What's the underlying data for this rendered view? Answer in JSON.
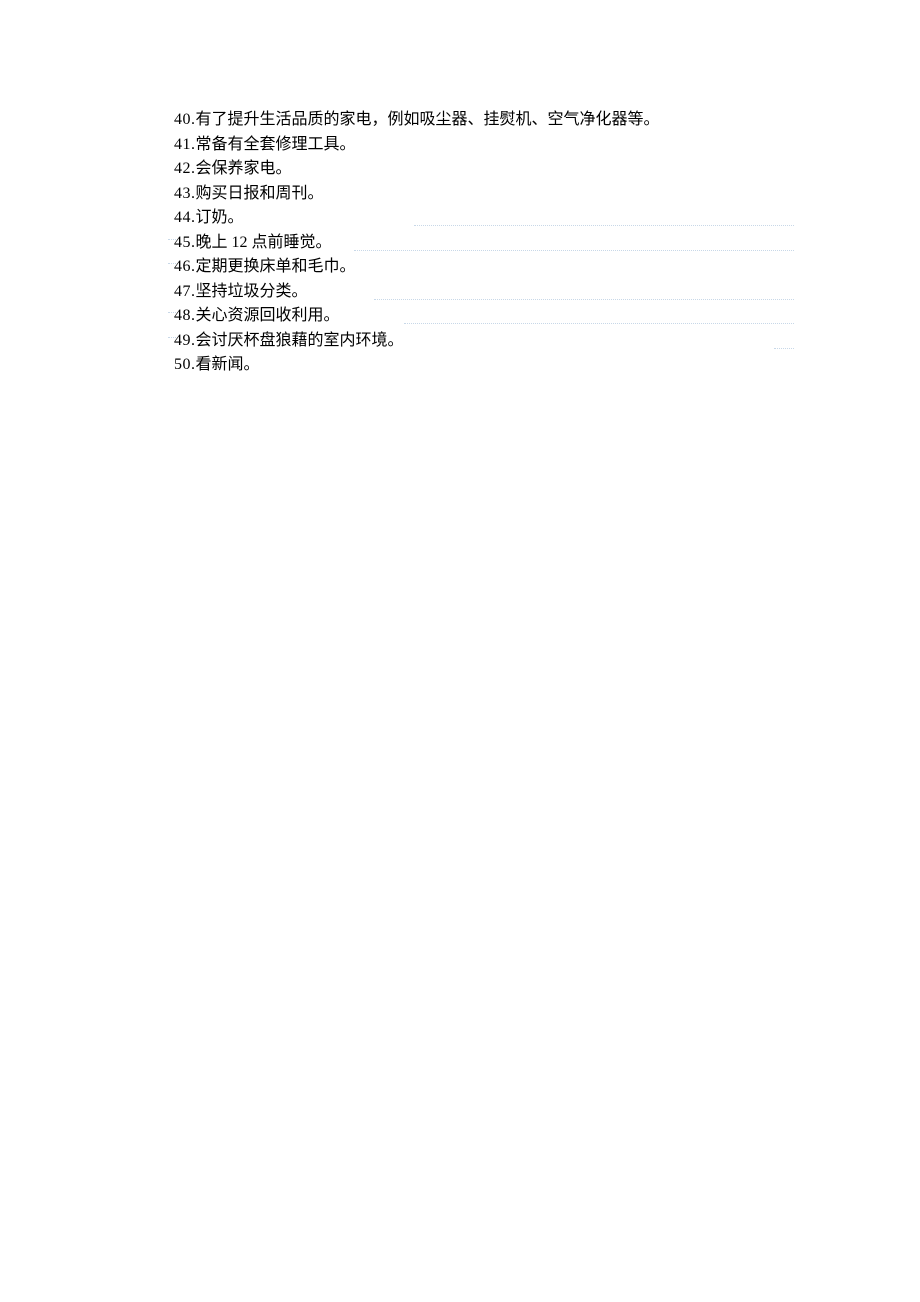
{
  "items": [
    {
      "number": "40.",
      "text": "有了提升生活品质的家电，例如吸尘器、挂熨机、空气净化器等。"
    },
    {
      "number": "41.",
      "text": "常备有全套修理工具。"
    },
    {
      "number": "42.",
      "text": "会保养家电。"
    },
    {
      "number": "43.",
      "text": "购买日报和周刊。"
    },
    {
      "number": "44.",
      "text": "订奶。"
    },
    {
      "number": "45.",
      "text": "晚上 12 点前睡觉。"
    },
    {
      "number": "46.",
      "text": "定期更换床单和毛巾。"
    },
    {
      "number": "47.",
      "text": "坚持垃圾分类。"
    },
    {
      "number": "48.",
      "text": "关心资源回收利用。"
    },
    {
      "number": "49.",
      "text": "会讨厌杯盘狼藉的室内环境。"
    },
    {
      "number": "50.",
      "text": "看新闻。"
    }
  ]
}
